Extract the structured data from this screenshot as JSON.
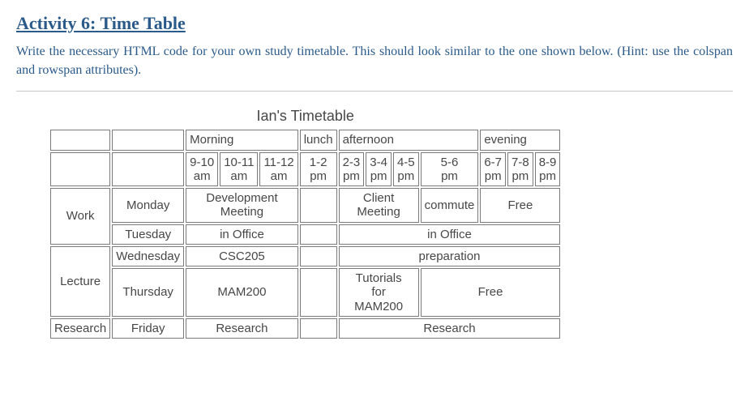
{
  "heading": "Activity 6: Time Table",
  "instructions": "Write the necessary HTML code for your own study timetable. This should look similar to the one shown below. (Hint: use the colspan and rowspan attributes).",
  "caption": "Ian's Timetable",
  "sections": {
    "morning": "Morning",
    "lunch": "lunch",
    "afternoon": "afternoon",
    "evening": "evening"
  },
  "slots": {
    "s9_10": "9-10 am",
    "s10_11": "10-11 am",
    "s11_12": "11-12 am",
    "s1_2": "1-2 pm",
    "s2_3": "2-3 pm",
    "s3_4": "3-4 pm",
    "s4_5": "4-5 pm",
    "s5_6": "5-6 pm",
    "s6_7": "6-7 pm",
    "s7_8": "7-8 pm",
    "s8_9": "8-9 pm"
  },
  "categories": {
    "work": "Work",
    "lecture": "Lecture",
    "research": "Research"
  },
  "days": {
    "mon": "Monday",
    "tue": "Tuesday",
    "wed": "Wednesday",
    "thu": "Thursday",
    "fri": "Friday"
  },
  "cells": {
    "dev_meeting": "Development Meeting",
    "client_meeting": "Client Meeting",
    "commute": "commute",
    "free": "Free",
    "in_office": "in Office",
    "csc205": "CSC205",
    "preparation": "preparation",
    "mam200": "MAM200",
    "tut_mam200": "Tutorials for MAM200",
    "research": "Research"
  },
  "chart_data": {
    "type": "table",
    "title": "Ian's Timetable",
    "column_sections": [
      {
        "name": "Morning",
        "slots": [
          "9-10 am",
          "10-11 am",
          "11-12 am"
        ]
      },
      {
        "name": "lunch",
        "slots": [
          "1-2 pm"
        ]
      },
      {
        "name": "afternoon",
        "slots": [
          "2-3 pm",
          "3-4 pm",
          "4-5 pm",
          "5-6 pm"
        ]
      },
      {
        "name": "evening",
        "slots": [
          "6-7 pm",
          "7-8 pm",
          "8-9 pm"
        ]
      }
    ],
    "rows": [
      {
        "category": "Work",
        "day": "Monday",
        "entries": [
          {
            "slots": [
              "9-10 am",
              "10-11 am",
              "11-12 am"
            ],
            "text": "Development Meeting"
          },
          {
            "slots": [
              "2-3 pm",
              "3-4 pm",
              "4-5 pm"
            ],
            "text": "Client Meeting"
          },
          {
            "slots": [
              "5-6 pm"
            ],
            "text": "commute"
          },
          {
            "slots": [
              "6-7 pm",
              "7-8 pm",
              "8-9 pm"
            ],
            "text": "Free"
          }
        ]
      },
      {
        "category": "Work",
        "day": "Tuesday",
        "entries": [
          {
            "slots": [
              "9-10 am",
              "10-11 am",
              "11-12 am"
            ],
            "text": "in Office"
          },
          {
            "slots": [
              "2-3 pm",
              "3-4 pm",
              "4-5 pm",
              "5-6 pm",
              "6-7 pm",
              "7-8 pm",
              "8-9 pm"
            ],
            "text": "in Office"
          }
        ]
      },
      {
        "category": "Lecture",
        "day": "Wednesday",
        "entries": [
          {
            "slots": [
              "9-10 am",
              "10-11 am",
              "11-12 am"
            ],
            "text": "CSC205"
          },
          {
            "slots": [
              "2-3 pm",
              "3-4 pm",
              "4-5 pm",
              "5-6 pm",
              "6-7 pm",
              "7-8 pm",
              "8-9 pm"
            ],
            "text": "preparation"
          }
        ]
      },
      {
        "category": "Lecture",
        "day": "Thursday",
        "entries": [
          {
            "slots": [
              "9-10 am",
              "10-11 am",
              "11-12 am"
            ],
            "text": "MAM200"
          },
          {
            "slots": [
              "2-3 pm",
              "3-4 pm",
              "4-5 pm"
            ],
            "text": "Tutorials for MAM200"
          },
          {
            "slots": [
              "5-6 pm",
              "6-7 pm",
              "7-8 pm",
              "8-9 pm"
            ],
            "text": "Free"
          }
        ]
      },
      {
        "category": "Research",
        "day": "Friday",
        "entries": [
          {
            "slots": [
              "9-10 am",
              "10-11 am",
              "11-12 am"
            ],
            "text": "Research"
          },
          {
            "slots": [
              "2-3 pm",
              "3-4 pm",
              "4-5 pm",
              "5-6 pm",
              "6-7 pm",
              "7-8 pm",
              "8-9 pm"
            ],
            "text": "Research"
          }
        ]
      }
    ]
  }
}
